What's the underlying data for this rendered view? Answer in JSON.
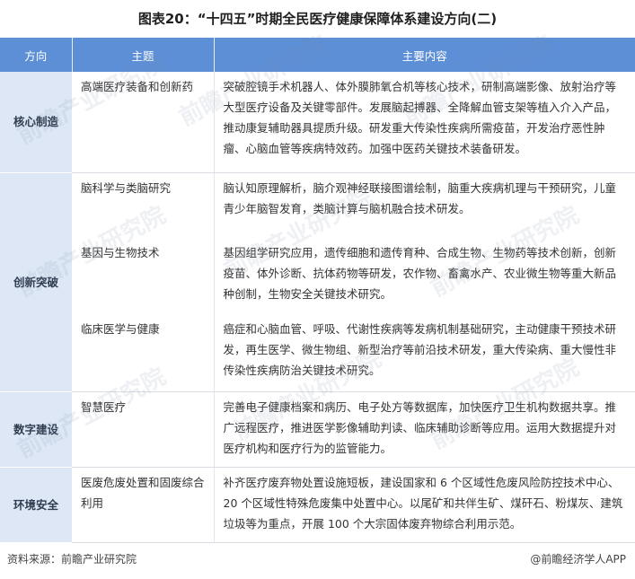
{
  "title": "图表20：“十四五”时期全民医疗健康保障体系建设方向(二)",
  "table": {
    "headers": [
      "方向",
      "主题",
      "主要内容"
    ],
    "groups": [
      {
        "direction": "核心制造",
        "rows": [
          {
            "topic": "高端医疗装备和创新药",
            "content": "突破腔镜手术机器人、体外膜肺氧合机等核心技术，研制高端影像、放射治疗等大型医疗设备及关键零部件。发展脑起搏器、全降解血管支架等植入介入产品，推动康复辅助器具提质升级。研发重大传染性疾病所需疫苗，开发治疗恶性肿瘤、心脑血管等疾病特效药。加强中医药关键技术装备研发。"
          }
        ]
      },
      {
        "direction": "创新突破",
        "rows": [
          {
            "topic": "脑科学与类脑研究",
            "content": "脑认知原理解析，脑介观神经联接图谱绘制，脑重大疾病机理与干预研究，儿童青少年脑智发育，类脑计算与脑机融合技术研发。"
          },
          {
            "topic": "基因与生物技术",
            "content": "基因组学研究应用，遗传细胞和遗传育种、合成生物、生物药等技术创新，创新疫苗、体外诊断、抗体药物等研发，农作物、畜禽水产、农业微生物等重大新品种创制，生物安全关键技术研究。"
          },
          {
            "topic": "临床医学与健康",
            "content": "癌症和心脑血管、呼吸、代谢性疾病等发病机制基础研究，主动健康干预技术研发，再生医学、微生物组、新型治疗等前沿技术研发，重大传染病、重大慢性非传染性疾病防治关键技术研究。"
          }
        ]
      },
      {
        "direction": "数字建设",
        "rows": [
          {
            "topic": "智慧医疗",
            "content": "完善电子健康档案和病历、电子处方等数据库，加快医疗卫生机构数据共享。推广远程医疗，推进医学影像辅助判读、临床辅助诊断等应用。运用大数据提升对医疗机构和医疗行为的监管能力。"
          }
        ]
      },
      {
        "direction": "环境安全",
        "rows": [
          {
            "topic": "医废危废处置和固废综合利用",
            "content": "补齐医疗废弃物处置设施短板，建设国家和 6 个区域性危废风险防控技术中心、20 个区域性特殊危废集中处置中心。以尾矿和共伴生矿、煤矸石、粉煤灰、建筑垃圾等为重点，开展 100 个大宗固体废弃物综合利用示范。"
          }
        ]
      }
    ]
  },
  "footer": {
    "source": "资料来源：前瞻产业研究院",
    "brand": "@前瞻经济学人APP"
  },
  "watermark": {
    "text": "前瞻产业研究院"
  },
  "colors": {
    "header_bg": "#5c8fd6",
    "direction_bg": "#dde7f5"
  }
}
